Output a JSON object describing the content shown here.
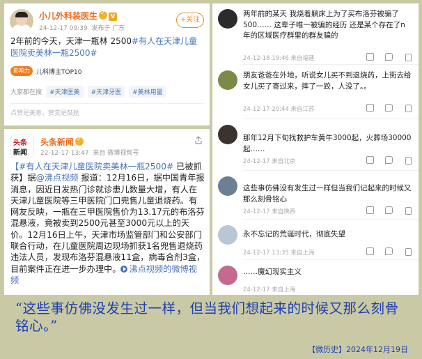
{
  "post1": {
    "author": "小儿外科装医生",
    "time": "24-12-17 09:39",
    "location": "发布于 广东",
    "follow_label": "+关注",
    "text_plain": "2年前的今天，天津一瓶林 2500",
    "text_link": "#有人在天津儿童医院卖美林一瓶2500#",
    "hot_badge": "影响力",
    "rank_label": "儿科博主TOP10",
    "everyone_label": "大家都在搜",
    "chips": [
      "#天津医美",
      "#天津牙医",
      "#美林用量"
    ],
    "footer": "点赞是美意，赞赏是鼓励"
  },
  "post2": {
    "author": "头条新闻",
    "avatar_top": "头条",
    "avatar_bottom": "新闻",
    "time": "22-12-17 13:47",
    "source": "来自 微博视频号",
    "text_link1": "【#有人在天津儿童医院卖美林一瓶2500#",
    "text_1": " 已被抓获】据",
    "text_link2": "@沸点视频",
    "text_2": " 报道：12月16日，据中国青年报消息，因近日发热门诊就诊患儿数量大增，有人在天津儿童医院等三甲医院门口兜售儿童退烧药。有网友反映，一瓶在三甲医院售价为13.17元的布洛芬混悬液，竟被卖到2500元甚至3000元以上的天价。12月16日上午，天津市场监管部门和公安部门联合行动，在儿童医院周边现场抓获1名兜售退烧药违法人员，发现布洛芬混悬液11盒，病毒合剂3盒，目前案件正在进一步办理中。",
    "text_link3": "沸点视频的微博视频"
  },
  "comments": [
    {
      "text": "两年前的某天 我烧着躺床上为了买布洛芬被骗了500…… 这辈子唯一被骗的经历 还是某个存在了n年的区域医疗群里的群友骗的",
      "meta": "24-12-18 19:46 来自福建"
    },
    {
      "text": "朋友爸爸在外地，听说女儿买不到退烧药，上街去给女儿买了寄过来，摔了一跤，人没了。。",
      "meta": "24-12-17 20:44 来自江苏"
    },
    {
      "text": "那年12月下旬找救护车黄牛3000起，火葬场30000起……",
      "meta": "24-12-17 来自北京"
    },
    {
      "text": "这些事仿佛没有发生过一样但当我们记起来的时候又那么刻骨铭心",
      "meta": "24-12-17 来自陕西"
    },
    {
      "text": "永不忘记的荒诞时代，彻底失望",
      "meta": "24-12-17 13:35 来自上海"
    },
    {
      "text": "……魔幻现实主义",
      "meta": "24-12-17 来自上海"
    }
  ],
  "caption": "“这些事仿佛没发生过一样，但当我们想起来的时候又那么刻骨铭心。”",
  "credit": "【微历史】2024年12月19日"
}
